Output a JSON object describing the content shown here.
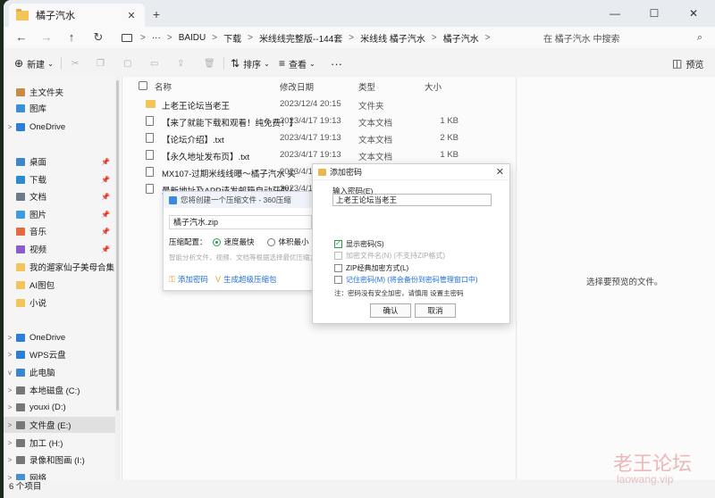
{
  "window": {
    "tab_title": "橘子汽水",
    "new_tab": "+",
    "controls": {
      "minimize": "—",
      "maximize": "☐",
      "close": "✕"
    }
  },
  "address": {
    "more": "···",
    "crumbs": [
      "BAIDU",
      "下载",
      "米线线完整版--144套",
      "米线线 橘子汽水",
      "橘子汽水"
    ],
    "separator": ">",
    "search_placeholder": "在 橘子汽水 中搜索"
  },
  "toolbar": {
    "new_label": "新建",
    "sort_label": "排序",
    "view_label": "查看",
    "more": "···",
    "preview_label": "预览"
  },
  "sidebar": {
    "items": [
      {
        "label": "主文件夹",
        "icon": "home-icon",
        "arrow": "",
        "pin": false
      },
      {
        "label": "图库",
        "icon": "gallery-icon",
        "arrow": "",
        "pin": false
      },
      {
        "label": "OneDrive",
        "icon": "cloud-icon",
        "arrow": ">",
        "pin": false
      },
      {
        "label": "桌面",
        "icon": "desktop-icon",
        "arrow": "",
        "pin": true
      },
      {
        "label": "下载",
        "icon": "download-icon",
        "arrow": "",
        "pin": true
      },
      {
        "label": "文档",
        "icon": "document-icon",
        "arrow": "",
        "pin": true
      },
      {
        "label": "图片",
        "icon": "picture-icon",
        "arrow": "",
        "pin": true
      },
      {
        "label": "音乐",
        "icon": "music-icon",
        "arrow": "",
        "pin": true
      },
      {
        "label": "视频",
        "icon": "video-icon",
        "arrow": "",
        "pin": true
      },
      {
        "label": "我的遛家仙子美母合集",
        "icon": "folder-icon",
        "arrow": "",
        "pin": false
      },
      {
        "label": "AI图包",
        "icon": "folder-icon",
        "arrow": "",
        "pin": false
      },
      {
        "label": "小说",
        "icon": "folder-icon",
        "arrow": "",
        "pin": false
      },
      {
        "label": "OneDrive",
        "icon": "cloud-icon",
        "arrow": ">",
        "pin": false
      },
      {
        "label": "WPS云盘",
        "icon": "cloud-icon",
        "arrow": ">",
        "pin": false
      },
      {
        "label": "此电脑",
        "icon": "computer-icon",
        "arrow": "v",
        "pin": false
      },
      {
        "label": "本地磁盘 (C:)",
        "icon": "drive-icon",
        "arrow": ">",
        "pin": false
      },
      {
        "label": "youxi (D:)",
        "icon": "drive-icon",
        "arrow": ">",
        "pin": false
      },
      {
        "label": "文件盘 (E:)",
        "icon": "drive-icon",
        "arrow": ">",
        "pin": false
      },
      {
        "label": "加工 (H:)",
        "icon": "drive-icon",
        "arrow": ">",
        "pin": false
      },
      {
        "label": "录像和图画 (I:)",
        "icon": "drive-icon",
        "arrow": ">",
        "pin": false
      },
      {
        "label": "网络",
        "icon": "network-icon",
        "arrow": ">",
        "pin": false
      }
    ]
  },
  "files": {
    "columns": {
      "name": "名称",
      "date": "修改日期",
      "type": "类型",
      "size": "大小"
    },
    "rows": [
      {
        "name": "上老王论坛当老王",
        "date": "2023/12/4 20:15",
        "type": "文件夹",
        "size": "",
        "kind": "folder"
      },
      {
        "name": "【来了就能下载和观看！纯免费！】.txt",
        "date": "2023/4/17 19:13",
        "type": "文本文档",
        "size": "1 KB",
        "kind": "txt"
      },
      {
        "name": "【论坛介绍】.txt",
        "date": "2023/4/17 19:13",
        "type": "文本文档",
        "size": "2 KB",
        "kind": "txt"
      },
      {
        "name": "【永久地址发布页】.txt",
        "date": "2023/4/17 19:13",
        "type": "文本文档",
        "size": "1 KB",
        "kind": "txt"
      },
      {
        "name": "MX107-过期米线线曝～橘子汽水 实...",
        "date": "2023/4/17 19:13",
        "type": "",
        "size": "",
        "kind": "txt"
      },
      {
        "name": "最新地址及APP请发邮箱自动获取！！...",
        "date": "2023/4/17 19:13",
        "type": "",
        "size": "",
        "kind": "txt"
      }
    ]
  },
  "preview_pane": {
    "message": "选择要预览的文件。"
  },
  "status": {
    "count": "6 个项目"
  },
  "zip_popup": {
    "title": "您将创建一个压缩文件 - 360压缩",
    "filename": "橘子汽水.zip",
    "config_label": "压缩配置：",
    "opt_fast": "速度最快",
    "opt_small": "体积最小",
    "hint": "智能分析文件，视频、文档等根据选择最优压缩方式。更...",
    "add_password": "添加密码",
    "generate": "生成超级压缩包"
  },
  "password_dialog": {
    "title": "添加密码",
    "input_label": "输入密码(E)",
    "password_value": "上老王论坛当老王",
    "show_password": "显示密码(S)",
    "encrypt_names": "加密文件名(N) (不支持ZIP格式)",
    "zip_classic": "ZIP经典加密方式(L)",
    "remember": "记住密码(M) (将会备份到密码管理窗口中)",
    "note_prefix": "注：密码没有安全加密，请慎用 设置主密码",
    "ok": "确认",
    "cancel": "取消"
  },
  "watermark": {
    "text": "老王论坛",
    "url": "laowang.vip"
  }
}
